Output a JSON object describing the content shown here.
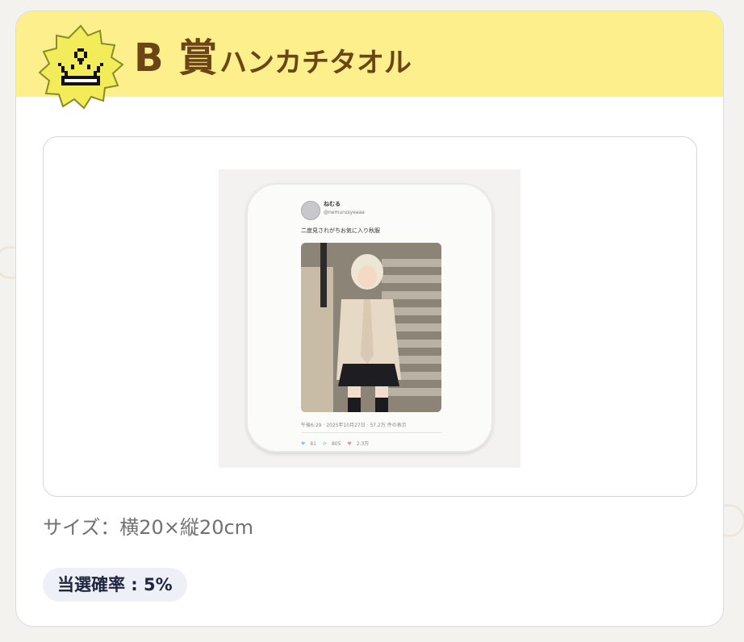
{
  "prize": {
    "grade": "B 賞",
    "name": "ハンカチタオル",
    "size_text": "サイズ：横20×縦20cm",
    "probability_text": "当選確率 : 5%"
  },
  "product_image": {
    "tweet": {
      "display_name": "ねむる",
      "handle": "@nemurusyeaaa",
      "text": "二度見されがちお気に入り秋服",
      "meta": "午後6:29 · 2025年10月27日 · 57.2万 件の表示",
      "likes_blue": "81",
      "retweets": "805",
      "likes": "2.3万"
    }
  },
  "colors": {
    "header_bg": "#fcef8c",
    "title_color": "#6b4516",
    "badge_fill": "#f2ec5a",
    "pill_bg": "#edf0f7"
  },
  "icons": {
    "badge": "crown-badge-icon"
  }
}
